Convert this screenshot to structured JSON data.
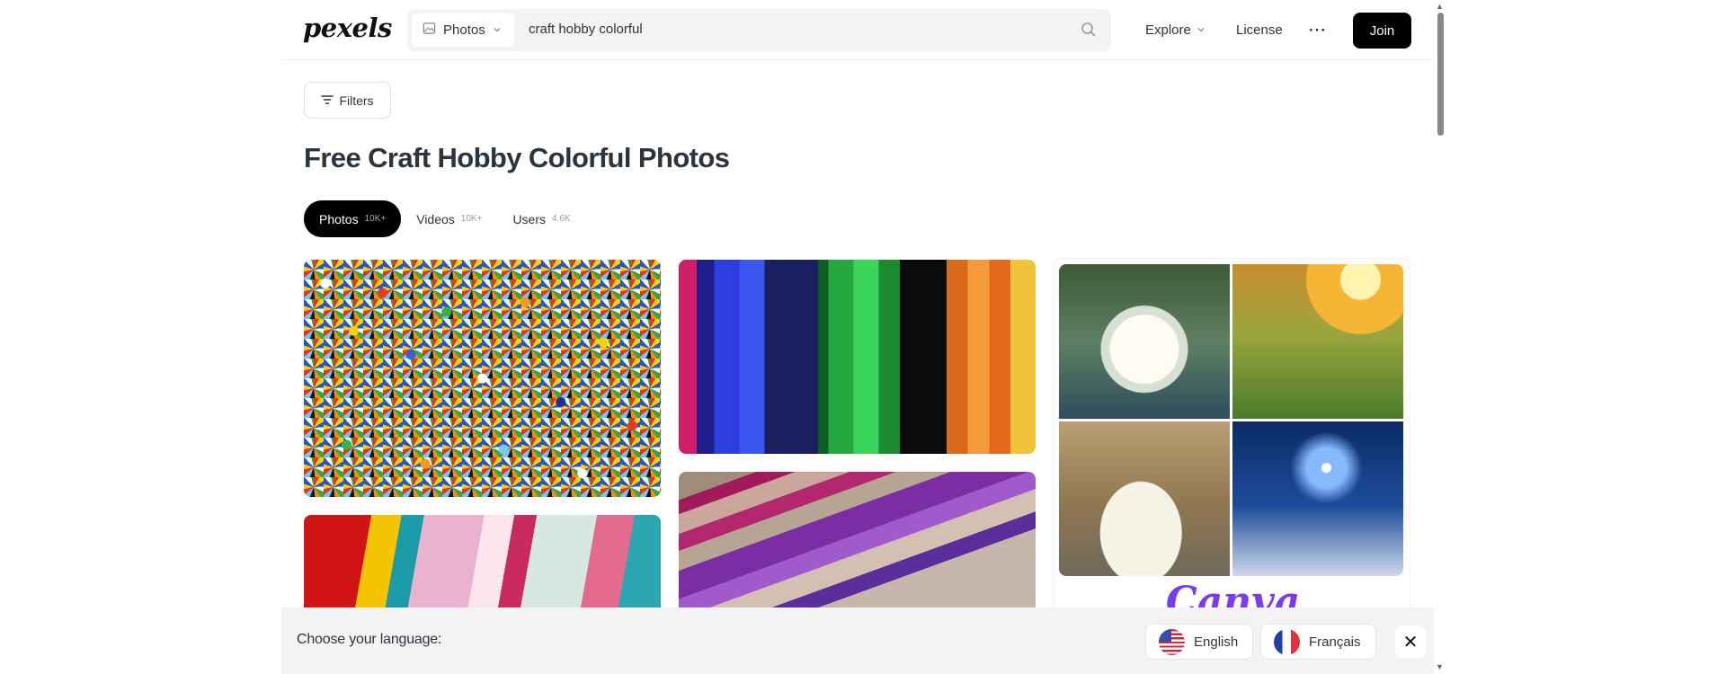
{
  "header": {
    "logo": "pexels",
    "search": {
      "type_label": "Photos",
      "query": "craft hobby colorful"
    },
    "nav": {
      "explore": "Explore",
      "license": "License",
      "more": "···",
      "join": "Join"
    }
  },
  "toolbar": {
    "filters_label": "Filters"
  },
  "page": {
    "title": "Free Craft Hobby Colorful Photos"
  },
  "tabs": [
    {
      "label": "Photos",
      "count": "10K+",
      "active": true
    },
    {
      "label": "Videos",
      "count": "10K+",
      "active": false
    },
    {
      "label": "Users",
      "count": "4.6K",
      "active": false
    }
  ],
  "ad": {
    "brand": "Canva"
  },
  "language_bar": {
    "prompt": "Choose your language:",
    "options": [
      "English",
      "Français"
    ],
    "close": "✕"
  },
  "icons": {
    "search": "search-icon",
    "image": "image-icon",
    "chevron": "chevron-down-icon",
    "filters": "filters-icon",
    "close": "close-icon"
  },
  "colors": {
    "join_bg": "#000000",
    "active_tab_bg": "#000000",
    "text": "#2c343e",
    "search_bg": "#f3f3f3"
  }
}
